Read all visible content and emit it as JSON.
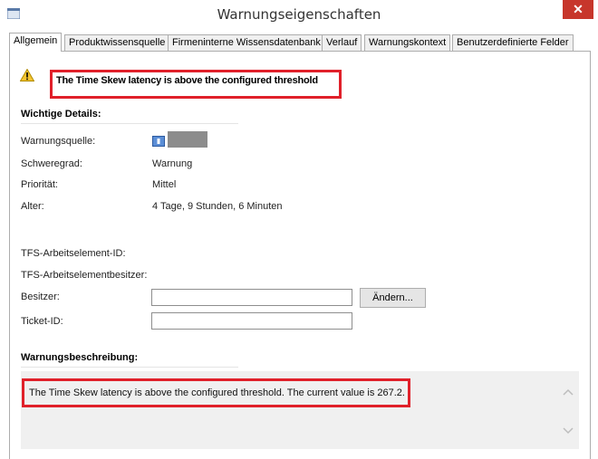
{
  "window": {
    "title": "Warnungseigenschaften",
    "close_symbol": "✕"
  },
  "tabs": [
    {
      "label": "Allgemein"
    },
    {
      "label": "Produktwissensquelle"
    },
    {
      "label": "Firmeninterne Wissensdatenbank"
    },
    {
      "label": "Verlauf"
    },
    {
      "label": "Warnungskontext"
    },
    {
      "label": "Benutzerdefinierte Felder"
    }
  ],
  "alert": {
    "headline": "The Time Skew latency is above the configured threshold"
  },
  "details": {
    "section_label": "Wichtige Details:",
    "rows": [
      {
        "label": "Warnungsquelle:",
        "value": ""
      },
      {
        "label": "Schweregrad:",
        "value": "Warnung"
      },
      {
        "label": "Priorität:",
        "value": "Mittel"
      },
      {
        "label": "Alter:",
        "value": "4 Tage, 9 Stunden, 6 Minuten"
      }
    ],
    "tfs_id_label": "TFS-Arbeitselement-ID:",
    "tfs_owner_label": "TFS-Arbeitselementbesitzer:",
    "owner_label": "Besitzer:",
    "owner_value": "",
    "change_button": "Ändern...",
    "ticket_label": "Ticket-ID:",
    "ticket_value": ""
  },
  "description": {
    "section_label": "Warnungsbeschreibung:",
    "text": "The Time Skew latency is above the configured threshold. The current value is 267.2."
  },
  "icons": {
    "app": "app-icon",
    "warning": "warning-icon",
    "source": "monitor-icon",
    "scroll_up": "chevron-up-icon",
    "scroll_down": "chevron-down-icon"
  },
  "colors": {
    "highlight": "#e0202a",
    "close_button": "#c7362b",
    "warning_yellow": "#f4c430"
  }
}
